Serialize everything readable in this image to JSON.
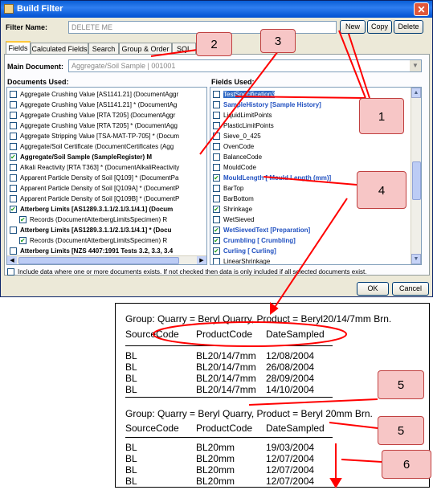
{
  "window": {
    "title": "Build Filter",
    "close_icon": "close-icon"
  },
  "filter": {
    "label": "Filter Name:",
    "value": "DELETE ME"
  },
  "toolbar": {
    "new": "New",
    "copy": "Copy",
    "delete": "Delete"
  },
  "tabs": [
    "Fields",
    "Calculated Fields",
    "Search",
    "Group & Order",
    "SQL"
  ],
  "main_document": {
    "label": "Main Document:",
    "value": "Aggregate/Soil Sample | 001001"
  },
  "documents": {
    "header": "Documents Used:",
    "items": [
      {
        "label": "Aggregate Crushing Value [AS1141.21] (DocumentAggr",
        "checked": false,
        "style": "normal"
      },
      {
        "label": "Aggregate Crushing Value [AS1141.21] * (DocumentAg",
        "checked": false,
        "style": "normal"
      },
      {
        "label": "Aggregate Crushing Value [RTA T205] (DocumentAggr",
        "checked": false,
        "style": "normal"
      },
      {
        "label": "Aggregate Crushing Value [RTA T205] * (DocumentAgg",
        "checked": false,
        "style": "normal"
      },
      {
        "label": "Aggregate Stripping Value [TSA-MAT-TP-705] * (Docum",
        "checked": false,
        "style": "normal"
      },
      {
        "label": "Aggregate/Soil Certificate (DocumentCertificates (Agg",
        "checked": false,
        "style": "normal"
      },
      {
        "label": "Aggregate/Soil Sample (SampleRegister) M",
        "checked": true,
        "style": "bold"
      },
      {
        "label": "Alkali Reactivity [RTA T363] * (DocumentAlkaliReactivity",
        "checked": false,
        "style": "normal"
      },
      {
        "label": "Apparent Particle Density of Soil [Q109] * (DocumentPa",
        "checked": false,
        "style": "normal"
      },
      {
        "label": "Apparent Particle Density of Soil [Q109A] * (DocumentP",
        "checked": false,
        "style": "normal"
      },
      {
        "label": "Apparent Particle Density of Soil [Q109B] * (DocumentP",
        "checked": false,
        "style": "normal"
      },
      {
        "label": "Atterberg Limits [AS1289.3.1.1/2.1/3.1/4.1] (Docum",
        "checked": true,
        "style": "bold"
      },
      {
        "label": "Records (DocumentAtterbergLimitsSpecimen) R",
        "checked": true,
        "style": "indent"
      },
      {
        "label": "Atterberg Limits [AS1289.3.1.1/2.1/3.1/4.1] * (Docu",
        "checked": false,
        "style": "bold"
      },
      {
        "label": "Records (DocumentAtterbergLimitsSpecimen) R",
        "checked": true,
        "style": "indent"
      },
      {
        "label": "Atterberg Limits [NZS 4407:1991 Tests 3.2, 3.3, 3.4",
        "checked": false,
        "style": "bold"
      }
    ]
  },
  "fields": {
    "header": "Fields Used:",
    "items": [
      {
        "label": "TestSpecification3",
        "checked": false,
        "style": "selected"
      },
      {
        "label": "SampleHistory [Sample History]",
        "checked": false,
        "style": "blue"
      },
      {
        "label": "LiquidLimitPoints",
        "checked": false,
        "style": "normal"
      },
      {
        "label": "PlasticLimitPoints",
        "checked": false,
        "style": "normal"
      },
      {
        "label": "Sieve_0_425",
        "checked": false,
        "style": "normal"
      },
      {
        "label": "OvenCode",
        "checked": false,
        "style": "normal"
      },
      {
        "label": "BalanceCode",
        "checked": false,
        "style": "normal"
      },
      {
        "label": "MouldCode",
        "checked": false,
        "style": "normal"
      },
      {
        "label": "MouldLength [ Mould Length (mm)]",
        "checked": true,
        "style": "blue"
      },
      {
        "label": "BarTop",
        "checked": false,
        "style": "normal"
      },
      {
        "label": "BarBottom",
        "checked": false,
        "style": "normal"
      },
      {
        "label": "Shrinkage",
        "checked": true,
        "style": "normal"
      },
      {
        "label": "WetSieved",
        "checked": false,
        "style": "normal"
      },
      {
        "label": "WetSievedText [Preparation]",
        "checked": true,
        "style": "blue"
      },
      {
        "label": "Crumbling [ Crumbling]",
        "checked": true,
        "style": "blue"
      },
      {
        "label": "Curling [ Curling]",
        "checked": true,
        "style": "blue"
      },
      {
        "label": "LinearShrinkage",
        "checked": false,
        "style": "normal"
      }
    ]
  },
  "include_note": "Include data where one or more documents exists. If not checked then data is only included if all selected documents exist.",
  "footer": {
    "ok": "OK",
    "cancel": "Cancel"
  },
  "callouts": [
    "1",
    "2",
    "3",
    "4",
    "5",
    "5",
    "6"
  ],
  "report": {
    "groups": [
      {
        "header": "Group: Quarry = Beryl Quarry, Product = Beryl20/14/7mm Brn.",
        "columns": [
          "SourceCode",
          "ProductCode",
          "DateSampled"
        ],
        "rows": [
          [
            "BL",
            "BL20/14/7mm",
            "12/08/2004"
          ],
          [
            "BL",
            "BL20/14/7mm",
            "26/08/2004"
          ],
          [
            "BL",
            "BL20/14/7mm",
            "28/09/2004"
          ],
          [
            "BL",
            "BL20/14/7mm",
            "14/10/2004"
          ]
        ]
      },
      {
        "header": "Group: Quarry = Beryl Quarry, Product = Beryl 20mm Brn.",
        "columns": [
          "SourceCode",
          "ProductCode",
          "DateSampled"
        ],
        "rows": [
          [
            "BL",
            "BL20mm",
            "19/03/2004"
          ],
          [
            "BL",
            "BL20mm",
            "12/07/2004"
          ],
          [
            "BL",
            "BL20mm",
            "12/07/2004"
          ],
          [
            "BL",
            "BL20mm",
            "12/07/2004"
          ]
        ]
      }
    ]
  },
  "colors": {
    "title_bar": "#0a5fd6",
    "callout_fill": "#f7c6c6",
    "arrow": "#ff0000"
  }
}
